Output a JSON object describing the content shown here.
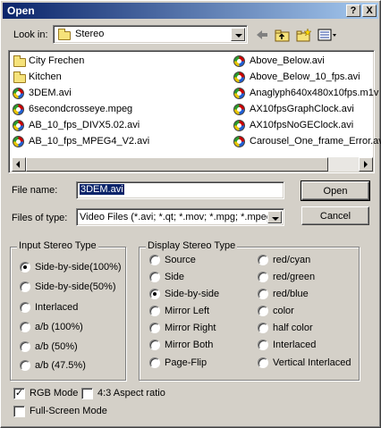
{
  "window": {
    "title": "Open",
    "help_label": "?",
    "close_label": "X"
  },
  "lookin": {
    "label": "Look in:",
    "value": "Stereo"
  },
  "toolbar": {
    "back_icon": "back-arrow-icon",
    "up_icon": "up-folder-icon",
    "new_folder_icon": "new-folder-icon",
    "view_icon": "view-menu-icon"
  },
  "files": {
    "col1": [
      {
        "name": "City Frechen",
        "type": "folder"
      },
      {
        "name": "Kitchen",
        "type": "folder"
      },
      {
        "name": "3DEM.avi",
        "type": "avi"
      },
      {
        "name": "6secondcrosseye.mpeg",
        "type": "avi"
      },
      {
        "name": "AB_10_fps_DIVX5.02.avi",
        "type": "avi"
      },
      {
        "name": "AB_10_fps_MPEG4_V2.avi",
        "type": "avi"
      }
    ],
    "col2": [
      {
        "name": "Above_Below.avi",
        "type": "avi"
      },
      {
        "name": "Above_Below_10_fps.avi",
        "type": "avi"
      },
      {
        "name": "Anaglyph640x480x10fps.m1v",
        "type": "avi"
      },
      {
        "name": "AX10fpsGraphClock.avi",
        "type": "avi"
      },
      {
        "name": "AX10fpsNoGEClock.avi",
        "type": "avi"
      },
      {
        "name": "Carousel_One_frame_Error.avi",
        "type": "avi"
      }
    ]
  },
  "filename": {
    "label": "File name:",
    "value": "3DEM.avi"
  },
  "filetype": {
    "label": "Files of type:",
    "value": "Video Files (*.avi; *.qt; *.mov; *.mpg; *.mpeg;"
  },
  "buttons": {
    "open": "Open",
    "cancel": "Cancel"
  },
  "input_stereo": {
    "title": "Input Stereo Type",
    "options": [
      "Side-by-side(100%)",
      "Side-by-side(50%)",
      "Interlaced",
      "a/b (100%)",
      "a/b (50%)",
      "a/b (47.5%)"
    ],
    "selected": 0
  },
  "display_stereo": {
    "title": "Display Stereo Type",
    "col1": [
      "Source",
      "Side",
      "Side-by-side",
      "Mirror Left",
      "Mirror Right",
      "Mirror Both",
      "Page-Flip"
    ],
    "col2": [
      "red/cyan",
      "red/green",
      "red/blue",
      "color",
      "half color",
      "Interlaced",
      "Vertical Interlaced"
    ],
    "selected": "Side-by-side"
  },
  "options": {
    "rgb_mode": {
      "label": "RGB Mode",
      "checked": true
    },
    "aspect": {
      "label": "4:3 Aspect ratio",
      "checked": false
    },
    "fullscreen": {
      "label": "Full-Screen Mode",
      "checked": false
    }
  }
}
